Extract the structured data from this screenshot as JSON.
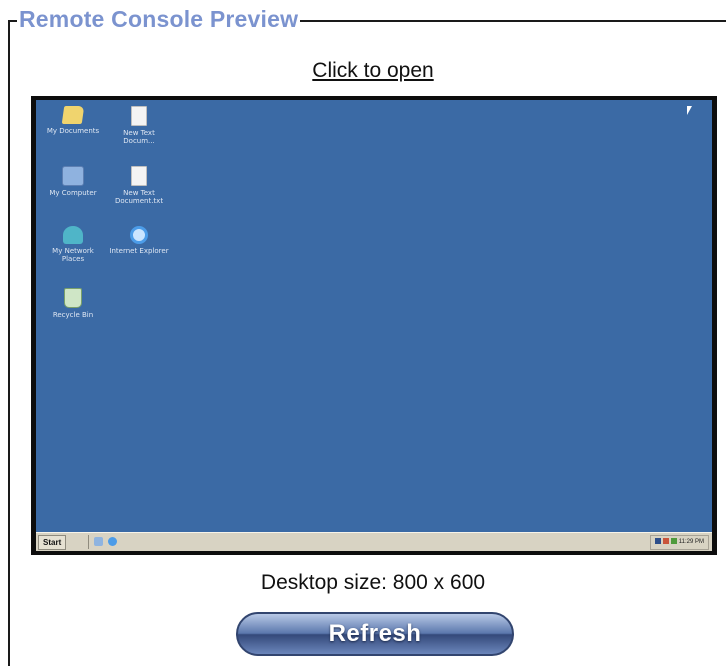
{
  "section": {
    "legend": "Remote Console Preview",
    "open_link": "Click to open"
  },
  "preview": {
    "desktop_color": "#3b6aa5",
    "icons": [
      {
        "label": "My Documents",
        "icon": "folder-icon"
      },
      {
        "label": "New Text Docum...",
        "icon": "document-icon"
      },
      {
        "label": "My Computer",
        "icon": "computer-icon"
      },
      {
        "label": "New Text Document.txt",
        "icon": "document-icon"
      },
      {
        "label": "My Network Places",
        "icon": "network-places-icon"
      },
      {
        "label": "Internet Explorer",
        "icon": "internet-explorer-icon"
      },
      {
        "label": "Recycle Bin",
        "icon": "recycle-bin-icon"
      }
    ],
    "taskbar": {
      "start_label": "Start",
      "clock": "11:29 PM"
    }
  },
  "info": {
    "desktop_size": "Desktop size: 800 x 600"
  },
  "actions": {
    "refresh_label": "Refresh"
  },
  "colors": {
    "legend": "#7b93cf",
    "button": "#4a6296"
  }
}
